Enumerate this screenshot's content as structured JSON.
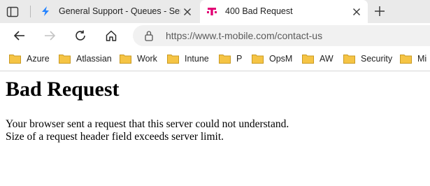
{
  "tabs": [
    {
      "title": "General Support - Queues - Service",
      "icon": "jira-service-icon",
      "active": false
    },
    {
      "title": "400 Bad Request",
      "icon": "t-mobile-icon",
      "active": true
    }
  ],
  "address_bar": {
    "url": "https://www.t-mobile.com/contact-us"
  },
  "bookmarks": [
    {
      "label": "Azure"
    },
    {
      "label": "Atlassian"
    },
    {
      "label": "Work"
    },
    {
      "label": "Intune"
    },
    {
      "label": "P"
    },
    {
      "label": "OpsM"
    },
    {
      "label": "AW"
    },
    {
      "label": "Security"
    },
    {
      "label": "Mi"
    }
  ],
  "page": {
    "title": "Bad Request",
    "message_line1": "Your browser sent a request that this server could not understand.",
    "message_line2": "Size of a request header field exceeds server limit."
  },
  "colors": {
    "tabstrip_bg": "#eaeaea",
    "jira_blue": "#2684ff",
    "t_mobile_magenta": "#e20074",
    "folder_yellow": "#f5c445"
  }
}
